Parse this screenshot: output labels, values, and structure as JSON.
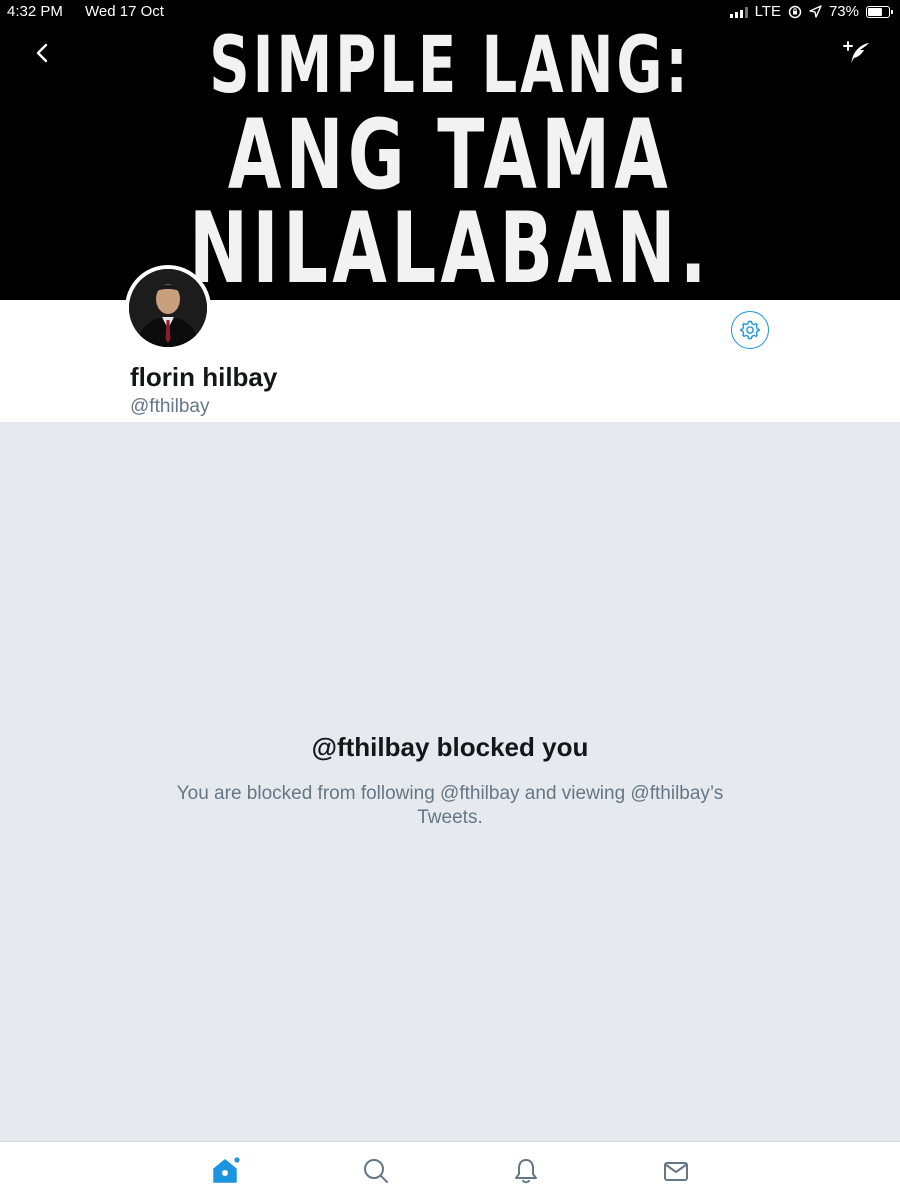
{
  "status_bar": {
    "time": "4:32 PM",
    "date": "Wed 17 Oct",
    "network": "LTE",
    "battery_percent": "73%",
    "battery_level": 0.73
  },
  "header": {
    "banner_lines": [
      "SIMPLE LANG:",
      "ANG TAMA",
      "NILALABAN."
    ],
    "back_icon": "chevron-left-icon",
    "compose_icon": "compose-tweet-icon"
  },
  "profile": {
    "display_name": "florin hilbay",
    "handle": "@fthilbay",
    "settings_icon": "gear-icon"
  },
  "blocked": {
    "title": "@fthilbay blocked you",
    "description": "You are blocked from following @fthilbay and viewing @fthilbay’s Tweets."
  },
  "tabbar": {
    "items": [
      "home-icon",
      "search-icon",
      "notifications-icon",
      "messages-icon"
    ],
    "active": "home-icon",
    "active_color": "#1b95e0",
    "inactive_color": "#657786"
  }
}
